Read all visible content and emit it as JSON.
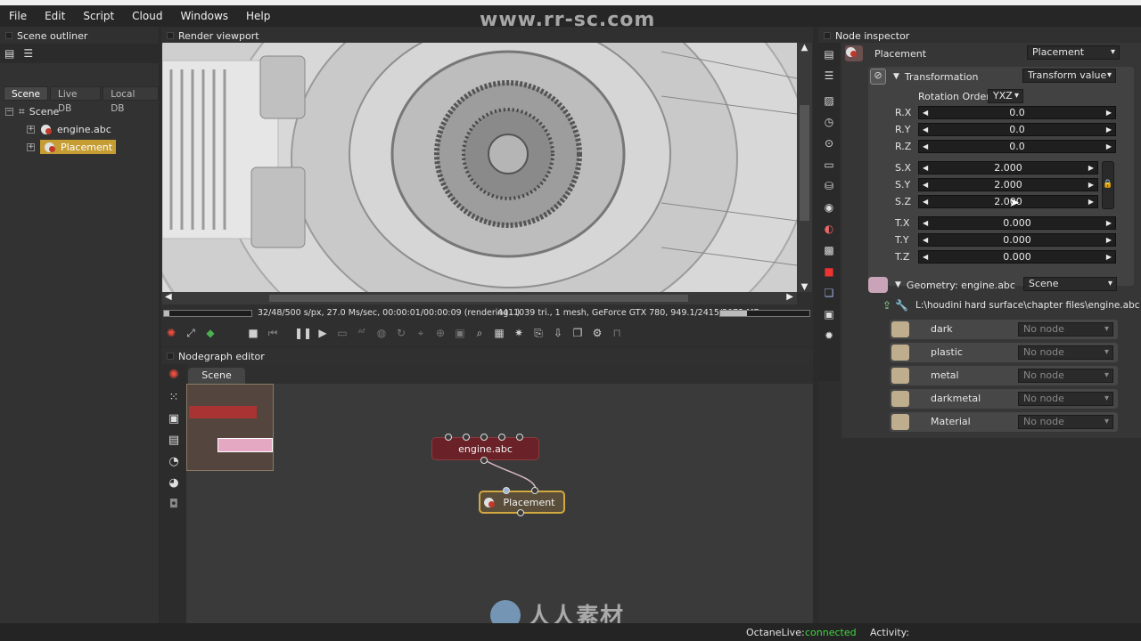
{
  "menu": [
    "File",
    "Edit",
    "Script",
    "Cloud",
    "Windows",
    "Help"
  ],
  "watermark": {
    "top": "www.rr-sc.com",
    "bottom": "人人素材"
  },
  "outliner": {
    "title": "Scene outliner",
    "tabs": [
      "Scene",
      "Live DB",
      "Local DB"
    ],
    "items": [
      {
        "label": "Scene"
      },
      {
        "label": "engine.abc"
      },
      {
        "label": "Placement"
      }
    ]
  },
  "viewport": {
    "title": "Render viewport",
    "status_left": "32/48/500 s/px, 27.0 Ms/sec, 00:00:01/00:00:09 (rendering...)",
    "status_right": "4411039 tri., 1 mesh, GeForce GTX 780, 949.1/2415/3072 MB",
    "progress": 0.06
  },
  "nodegraph": {
    "title": "Nodegraph editor",
    "tab": "Scene",
    "nodes": [
      {
        "label": "engine.abc"
      },
      {
        "label": "Placement"
      }
    ]
  },
  "inspector": {
    "title": "Node inspector",
    "node_name": "Placement",
    "node_type": "Placement",
    "transformation_label": "Transformation",
    "transformation_mode": "Transform value",
    "rotation_order_label": "Rotation Order",
    "rotation_order": "YXZ",
    "params": [
      {
        "label": "R.X",
        "value": "0.0"
      },
      {
        "label": "R.Y",
        "value": "0.0"
      },
      {
        "label": "R.Z",
        "value": "0.0"
      },
      {
        "label": "S.X",
        "value": "2.000"
      },
      {
        "label": "S.Y",
        "value": "2.000"
      },
      {
        "label": "S.Z",
        "value": "2.000"
      },
      {
        "label": "T.X",
        "value": "0.000"
      },
      {
        "label": "T.Y",
        "value": "0.000"
      },
      {
        "label": "T.Z",
        "value": "0.000"
      }
    ],
    "geometry_label": "Geometry: engine.abc",
    "geometry_mode": "Scene",
    "file_path": "L:\\houdini hard surface\\chapter files\\engine.abc",
    "materials": [
      {
        "label": "dark",
        "value": "No node"
      },
      {
        "label": "plastic",
        "value": "No node"
      },
      {
        "label": "metal",
        "value": "No node"
      },
      {
        "label": "darkmetal",
        "value": "No node"
      },
      {
        "label": "Material",
        "value": "No node"
      }
    ]
  },
  "statusbar": {
    "octanelive_label": "OctaneLive:",
    "octanelive_value": "connected",
    "activity_label": "Activity:",
    "connected_color": "#3fd63f"
  }
}
